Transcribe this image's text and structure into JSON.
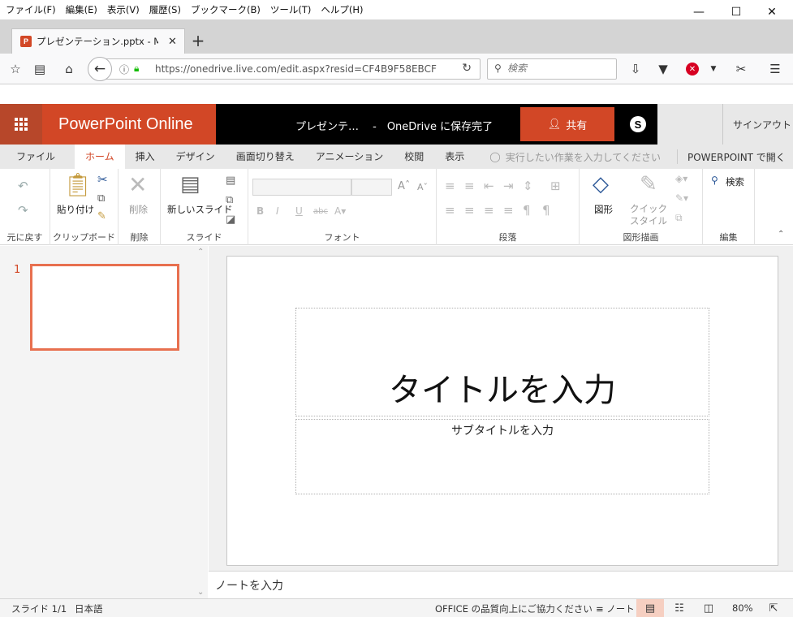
{
  "firefox": {
    "menu": [
      "ファイル(F)",
      "編集(E)",
      "表示(V)",
      "履歴(S)",
      "ブックマーク(B)",
      "ツール(T)",
      "ヘルプ(H)"
    ],
    "tab_title": "プレゼンテーション.pptx - Microsoft PowerPoint Online",
    "url": "https://onedrive.live.com/edit.aspx?resid=CF4B9F58EBCF",
    "search_placeholder": "検索"
  },
  "app": {
    "name": "PowerPoint Online",
    "doc_title": "プレゼンテ…　 -　OneDrive に保存完了",
    "share_label": "共有",
    "signin_label": "サインアウト",
    "brand_color": "#d24726"
  },
  "ribbon_tabs": [
    "ファイル",
    "ホーム",
    "挿入",
    "デザイン",
    "画面切り替え",
    "アニメーション",
    "校閲",
    "表示"
  ],
  "active_tab": "ホーム",
  "tell_me_placeholder": "実行したい作業を入力してください",
  "open_in_ppt": "POWERPOINT で開く",
  "ribbon": {
    "undo_group": "元に戻す",
    "clipboard_group": "クリップボード",
    "paste_label": "貼り付け",
    "delete_group": "削除",
    "delete_label": "削除",
    "slides_group": "スライド",
    "new_slide_label": "新しいスライド",
    "font_group": "フォント",
    "paragraph_group": "段落",
    "drawing_group": "図形描画",
    "shapes_label": "図形",
    "quick_style_label": "クイック\nスタイル",
    "editing_group": "編集",
    "find_label": "検索"
  },
  "thumbnails": [
    {
      "number": "1"
    }
  ],
  "slide": {
    "title_placeholder": "タイトルを入力",
    "subtitle_placeholder": "サブタイトルを入力"
  },
  "notes_placeholder": "ノートを入力",
  "status": {
    "slide_count": "スライド 1/1",
    "language": "日本語",
    "feedback": "OFFICE の品質向上にご協力ください",
    "notes_label": "ノート",
    "zoom": "80%"
  }
}
